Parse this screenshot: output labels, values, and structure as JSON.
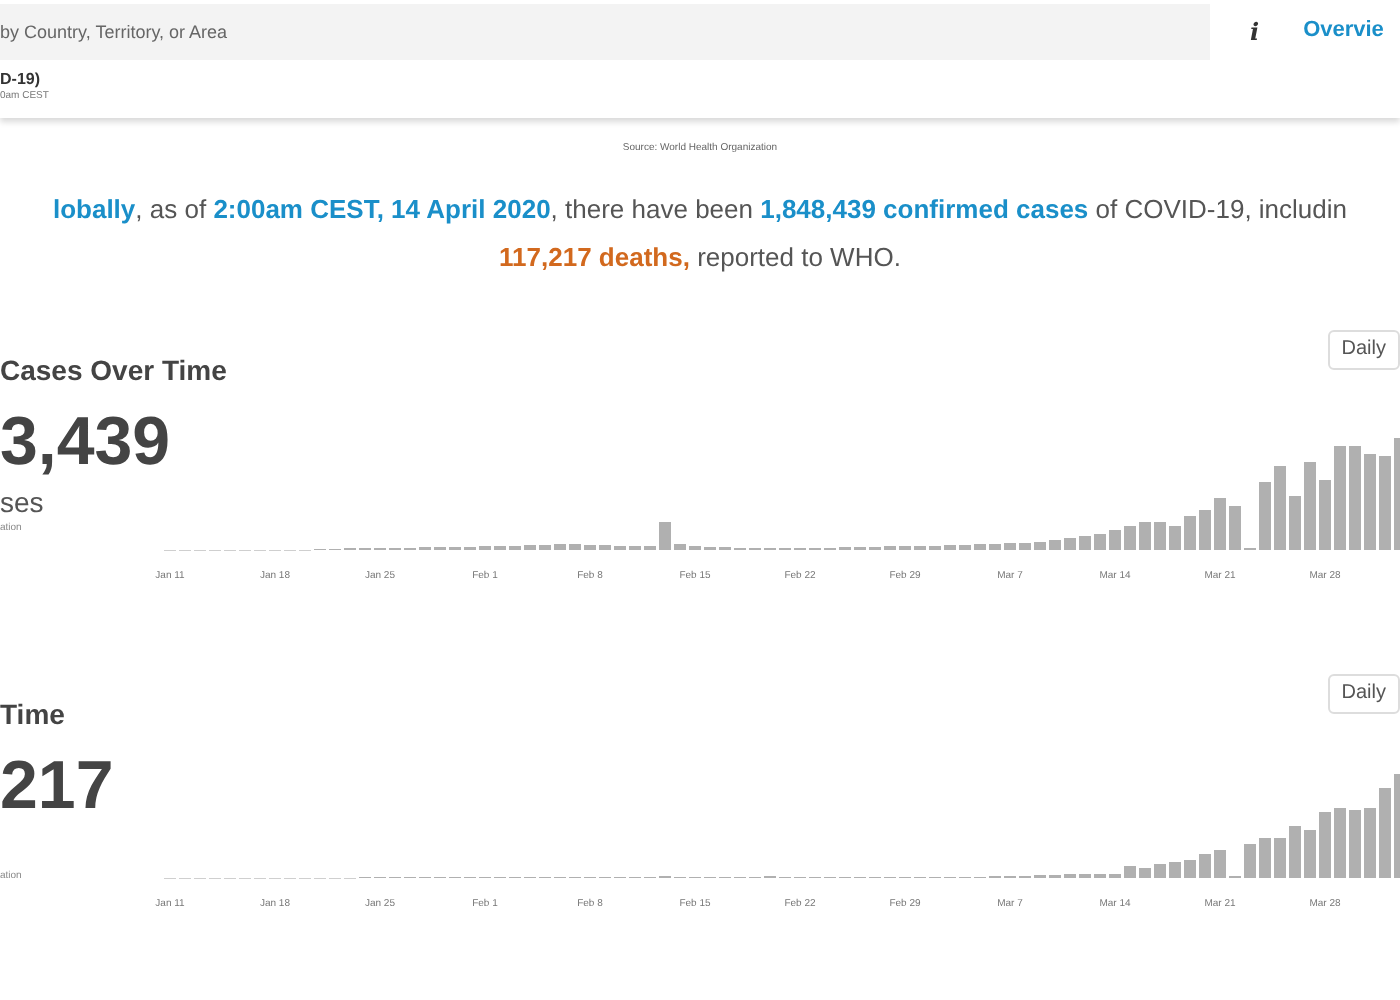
{
  "search": {
    "placeholder": "by Country, Territory, or Area"
  },
  "info_button": "i",
  "nav_link": "Overvie",
  "header": {
    "title": "D-19)",
    "subtitle": "0am CEST"
  },
  "source": "Source: World Health Organization",
  "summary": [
    [
      {
        "kind": "highlight",
        "text": "lobally"
      },
      {
        "kind": "plain",
        "text": ", as of "
      },
      {
        "kind": "highlight",
        "text": "2:00am CEST, 14 April 2020"
      },
      {
        "kind": "plain",
        "text": ", there have been "
      },
      {
        "kind": "highlight",
        "text": "1,848,439 confirmed cases"
      },
      {
        "kind": "plain",
        "text": " of COVID-19, includin"
      }
    ],
    [
      {
        "kind": "deaths",
        "text": "117,217 deaths,"
      },
      {
        "kind": "plain",
        "text": " reported to WHO."
      }
    ]
  ],
  "panels": [
    {
      "kind": "cases",
      "title": "Cases Over Time",
      "total": "3,439",
      "label": "ses",
      "note": "ation",
      "toggle": "Daily",
      "x_labels": [
        "Jan 11",
        "Jan 18",
        "Jan 25",
        "Feb 1",
        "Feb 8",
        "Feb 15",
        "Feb 22",
        "Feb 29",
        "Mar 7",
        "Mar 14",
        "Mar 21",
        "Mar 28"
      ]
    },
    {
      "kind": "deaths",
      "title": "Time",
      "total": "217",
      "note": "ation",
      "toggle": "Daily",
      "x_labels": [
        "Jan 11",
        "Jan 18",
        "Jan 25",
        "Feb 1",
        "Feb 8",
        "Feb 15",
        "Feb 22",
        "Feb 29",
        "Mar 7",
        "Mar 14",
        "Mar 21",
        "Mar 28"
      ]
    }
  ]
}
